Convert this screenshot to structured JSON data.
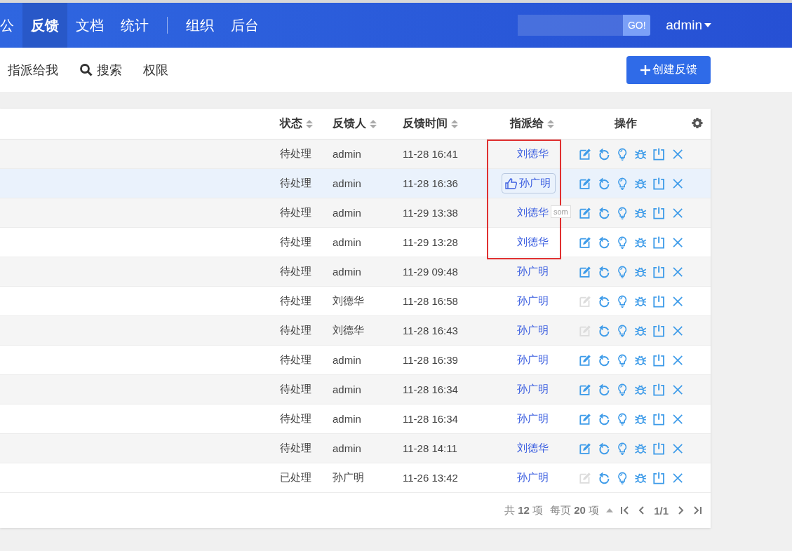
{
  "nav": {
    "items": [
      {
        "label": "公",
        "selected": false
      },
      {
        "label": "反馈",
        "selected": true
      },
      {
        "label": "文档",
        "selected": false
      },
      {
        "label": "统计",
        "selected": false
      }
    ],
    "admin_items": [
      {
        "label": "组织",
        "selected": false
      },
      {
        "label": "后台",
        "selected": false
      }
    ],
    "search": {
      "button": "GO!"
    },
    "user": "admin"
  },
  "subnav": {
    "items": [
      {
        "label": "指派给我",
        "kind": "plain"
      },
      {
        "label": "搜索",
        "kind": "search"
      },
      {
        "label": "权限",
        "kind": "plain"
      }
    ],
    "create_button": "创建反馈"
  },
  "table": {
    "columns": [
      {
        "label": "状态",
        "sortable": true
      },
      {
        "label": "反馈人",
        "sortable": true
      },
      {
        "label": "反馈时间",
        "sortable": true
      },
      {
        "label": "指派给",
        "sortable": true
      },
      {
        "label": "操作",
        "sortable": false
      }
    ],
    "rows": [
      {
        "status": "待处理",
        "reporter": "admin",
        "time": "11-28 16:41",
        "assignee": "刘德华",
        "hovered": false,
        "highlighted": true,
        "edit_disabled": false
      },
      {
        "status": "待处理",
        "reporter": "admin",
        "time": "11-28 16:36",
        "assignee": "孙广明",
        "hovered": true,
        "highlighted": true,
        "edit_disabled": false
      },
      {
        "status": "待处理",
        "reporter": "admin",
        "time": "11-29 13:38",
        "assignee": "刘德华",
        "hovered": false,
        "highlighted": true,
        "edit_disabled": false
      },
      {
        "status": "待处理",
        "reporter": "admin",
        "time": "11-29 13:28",
        "assignee": "刘德华",
        "hovered": false,
        "highlighted": true,
        "edit_disabled": false
      },
      {
        "status": "待处理",
        "reporter": "admin",
        "time": "11-29 09:48",
        "assignee": "孙广明",
        "hovered": false,
        "highlighted": false,
        "edit_disabled": false
      },
      {
        "status": "待处理",
        "reporter": "刘德华",
        "time": "11-28 16:58",
        "assignee": "孙广明",
        "hovered": false,
        "highlighted": false,
        "edit_disabled": true
      },
      {
        "status": "待处理",
        "reporter": "刘德华",
        "time": "11-28 16:43",
        "assignee": "孙广明",
        "hovered": false,
        "highlighted": false,
        "edit_disabled": true
      },
      {
        "status": "待处理",
        "reporter": "admin",
        "time": "11-28 16:39",
        "assignee": "孙广明",
        "hovered": false,
        "highlighted": false,
        "edit_disabled": false
      },
      {
        "status": "待处理",
        "reporter": "admin",
        "time": "11-28 16:34",
        "assignee": "孙广明",
        "hovered": false,
        "highlighted": false,
        "edit_disabled": false
      },
      {
        "status": "待处理",
        "reporter": "admin",
        "time": "11-28 16:34",
        "assignee": "孙广明",
        "hovered": false,
        "highlighted": false,
        "edit_disabled": false
      },
      {
        "status": "待处理",
        "reporter": "admin",
        "time": "11-28 14:11",
        "assignee": "刘德华",
        "hovered": false,
        "highlighted": false,
        "edit_disabled": false
      },
      {
        "status": "已处理",
        "reporter": "孙广明",
        "time": "11-26 13:42",
        "assignee": "孙广明",
        "hovered": false,
        "highlighted": false,
        "edit_disabled": true
      }
    ],
    "tooltip": "som"
  },
  "pager": {
    "total": "共 **12** 项",
    "page_size": "每页 **20** 项",
    "page": "1/1"
  }
}
